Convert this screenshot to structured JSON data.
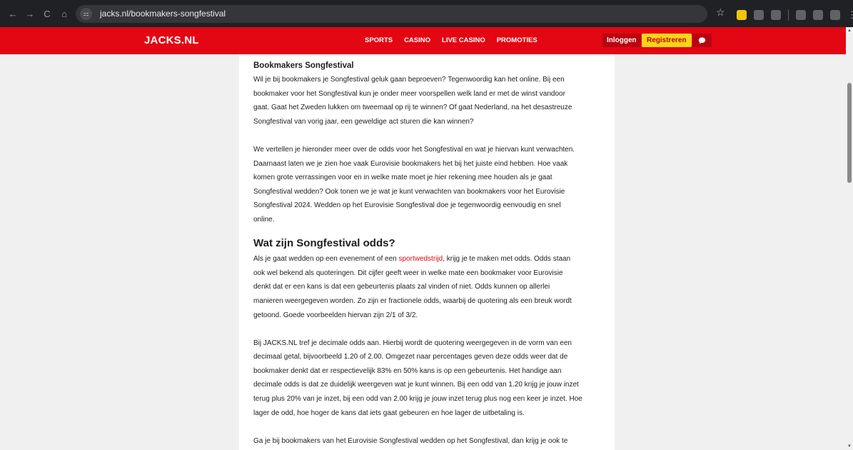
{
  "browser": {
    "url": "jacks.nl/bookmakers-songfestival",
    "nav": {
      "back": "←",
      "forward": "→",
      "reload": "C",
      "home": "⌂"
    },
    "site_info_icon": "⚏",
    "star_icon": "☆",
    "menu_icon": "⋮"
  },
  "header": {
    "logo": "JACKS.NL",
    "nav": [
      "SPORTS",
      "CASINO",
      "LIVE CASINO",
      "PROMOTIES"
    ],
    "login": "Inloggen",
    "register": "Registreren",
    "chat_icon": "chat-bubble"
  },
  "article": {
    "heading": "Bookmakers Songfestival",
    "intro": [
      "Wil je bij bookmakers je Songfestival geluk gaan beproeven? Tegenwoordig kan het online. Bij een",
      "bookmaker voor het Songfestival kun je onder meer voorspellen welk land er met de winst vandoor",
      "gaat. Gaat het Zweden lukken om tweemaal op rij te winnen? Of gaat Nederland, na het desastreuze",
      "Songfestival van vorig jaar, een geweldige act sturen die kan winnen?"
    ],
    "para2": [
      "We vertellen je hieronder meer over de odds voor het Songfestival en wat je hiervan kunt verwachten.",
      "Daarnaast laten we je zien hoe vaak Eurovisie bookmakers het bij het juiste eind hebben. Hoe vaak",
      "komen grote verrassingen voor en in welke mate moet je hier rekening mee houden als je gaat",
      "Songfestival wedden? Ook tonen we je wat je kunt verwachten van bookmakers voor het Eurovisie",
      "Songfestival 2024. Wedden op het Eurovisie Songfestival doe je tegenwoordig eenvoudig en snel",
      "online."
    ],
    "section_title": "Wat zijn Songfestival odds?",
    "odds_p1_start": "Als je gaat wedden op een evenement of een ",
    "odds_p1_link": "sportwedstrijd",
    "odds_p1_end": ", krijg je te maken met odds. Odds staan",
    "odds_p1_rest": [
      "ook wel bekend als quoteringen. Dit cijfer geeft weer in welke mate een bookmaker voor Eurovisie",
      "denkt dat er een kans is dat een gebeurtenis plaats zal vinden of niet. Odds kunnen op allerlei",
      "manieren weergegeven worden. Zo zijn er fractionele odds, waarbij de quotering als een breuk wordt",
      "getoond. Goede voorbeelden hiervan zijn 2/1 of 3/2."
    ],
    "odds_p2": [
      "Bij JACKS.NL tref je decimale odds aan. Hierbij wordt de quotering weergegeven in de vorm van een",
      "decimaal getal, bijvoorbeeld 1.20 of 2.00. Omgezet naar percentages geven deze odds weer dat de",
      "bookmaker denkt dat er respectievelijk 83% en 50% kans is op een gebeurtenis. Het handige aan",
      "decimale odds is dat ze duidelijk weergeven wat je kunt winnen. Bij een odd van 1.20 krijg je jouw inzet",
      "terug plus 20% van je inzet, bij een odd van 2.00 krijg je jouw inzet terug plus nog een keer je inzet. Hoe",
      "lager de odd, hoe hoger de kans dat iets gaat gebeuren en hoe lager de uitbetaling is."
    ],
    "cutoff_line": "Ga je bij bookmakers van het Eurovisie Songfestival wedden op het Songfestival, dan krijg je ook te"
  }
}
